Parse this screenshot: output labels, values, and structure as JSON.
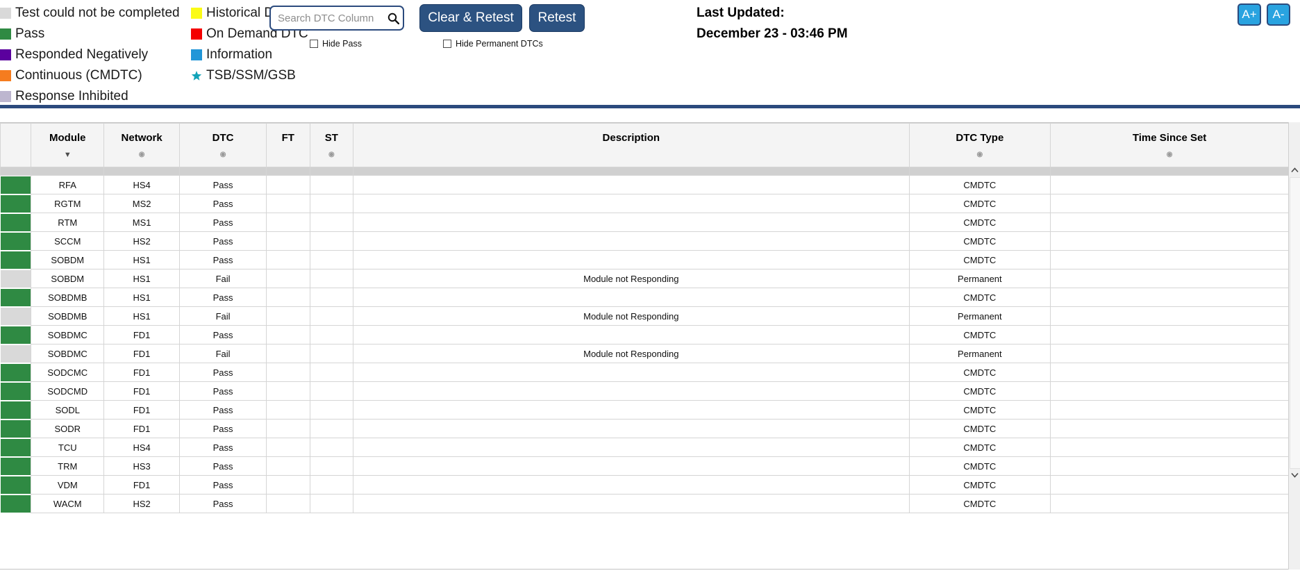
{
  "legend": {
    "left_column": [
      {
        "label": "Test could not be completed",
        "color": "#d9d9d9"
      },
      {
        "label": "Pass",
        "color": "#2f8a43"
      },
      {
        "label": "Responded Negatively",
        "color": "#5b009e"
      },
      {
        "label": "Continuous (CMDTC)",
        "color": "#f57c1f"
      },
      {
        "label": "Response Inhibited",
        "color": "#bdb6cf"
      }
    ],
    "right_column": [
      {
        "label": "Historical DTCs",
        "color": "#fbfb16",
        "icon": "square-swatch"
      },
      {
        "label": "On Demand DTC",
        "color": "#f40000",
        "icon": "square-swatch"
      },
      {
        "label": "Information",
        "color": "#2196d8",
        "icon": "square-swatch"
      },
      {
        "label": "TSB/SSM/GSB",
        "color": "#12a3b8",
        "icon": "star-icon"
      }
    ]
  },
  "toolbar": {
    "search_placeholder": "Search DTC Column",
    "search_value": "",
    "search_icon": "search-icon",
    "clear_retest_label": "Clear & Retest",
    "retest_label": "Retest",
    "hide_pass_label": "Hide Pass",
    "hide_pass_checked": false,
    "hide_permanent_label": "Hide Permanent DTCs",
    "hide_permanent_checked": false,
    "last_updated_title": "Last Updated:",
    "last_updated_value": "December 23 - 03:46 PM",
    "font_increase_label": "A+",
    "font_decrease_label": "A-",
    "accent_navy": "#2c5281",
    "accent_blue": "#29a3e0"
  },
  "table": {
    "columns": [
      {
        "key": "status",
        "label": "",
        "sort": ""
      },
      {
        "key": "module",
        "label": "Module",
        "sort": "▼"
      },
      {
        "key": "network",
        "label": "Network",
        "sort": "◉"
      },
      {
        "key": "dtc",
        "label": "DTC",
        "sort": "◉"
      },
      {
        "key": "ft",
        "label": "FT",
        "sort": ""
      },
      {
        "key": "st",
        "label": "ST",
        "sort": "◉"
      },
      {
        "key": "desc",
        "label": "Description",
        "sort": ""
      },
      {
        "key": "type",
        "label": "DTC Type",
        "sort": "◉"
      },
      {
        "key": "time",
        "label": "Time Since Set",
        "sort": "◉"
      }
    ],
    "rows": [
      {
        "status": "#2f8a43",
        "module": "RFA",
        "network": "HS4",
        "dtc": "Pass",
        "ft": "",
        "st": "",
        "desc": "",
        "type": "CMDTC",
        "time": ""
      },
      {
        "status": "#2f8a43",
        "module": "RGTM",
        "network": "MS2",
        "dtc": "Pass",
        "ft": "",
        "st": "",
        "desc": "",
        "type": "CMDTC",
        "time": ""
      },
      {
        "status": "#2f8a43",
        "module": "RTM",
        "network": "MS1",
        "dtc": "Pass",
        "ft": "",
        "st": "",
        "desc": "",
        "type": "CMDTC",
        "time": ""
      },
      {
        "status": "#2f8a43",
        "module": "SCCM",
        "network": "HS2",
        "dtc": "Pass",
        "ft": "",
        "st": "",
        "desc": "",
        "type": "CMDTC",
        "time": ""
      },
      {
        "status": "#2f8a43",
        "module": "SOBDM",
        "network": "HS1",
        "dtc": "Pass",
        "ft": "",
        "st": "",
        "desc": "",
        "type": "CMDTC",
        "time": ""
      },
      {
        "status": "#d9d9d9",
        "module": "SOBDM",
        "network": "HS1",
        "dtc": "Fail",
        "ft": "",
        "st": "",
        "desc": "Module not Responding",
        "type": "Permanent",
        "time": ""
      },
      {
        "status": "#2f8a43",
        "module": "SOBDMB",
        "network": "HS1",
        "dtc": "Pass",
        "ft": "",
        "st": "",
        "desc": "",
        "type": "CMDTC",
        "time": ""
      },
      {
        "status": "#d9d9d9",
        "module": "SOBDMB",
        "network": "HS1",
        "dtc": "Fail",
        "ft": "",
        "st": "",
        "desc": "Module not Responding",
        "type": "Permanent",
        "time": ""
      },
      {
        "status": "#2f8a43",
        "module": "SOBDMC",
        "network": "FD1",
        "dtc": "Pass",
        "ft": "",
        "st": "",
        "desc": "",
        "type": "CMDTC",
        "time": ""
      },
      {
        "status": "#d9d9d9",
        "module": "SOBDMC",
        "network": "FD1",
        "dtc": "Fail",
        "ft": "",
        "st": "",
        "desc": "Module not Responding",
        "type": "Permanent",
        "time": ""
      },
      {
        "status": "#2f8a43",
        "module": "SODCMC",
        "network": "FD1",
        "dtc": "Pass",
        "ft": "",
        "st": "",
        "desc": "",
        "type": "CMDTC",
        "time": ""
      },
      {
        "status": "#2f8a43",
        "module": "SODCMD",
        "network": "FD1",
        "dtc": "Pass",
        "ft": "",
        "st": "",
        "desc": "",
        "type": "CMDTC",
        "time": ""
      },
      {
        "status": "#2f8a43",
        "module": "SODL",
        "network": "FD1",
        "dtc": "Pass",
        "ft": "",
        "st": "",
        "desc": "",
        "type": "CMDTC",
        "time": ""
      },
      {
        "status": "#2f8a43",
        "module": "SODR",
        "network": "FD1",
        "dtc": "Pass",
        "ft": "",
        "st": "",
        "desc": "",
        "type": "CMDTC",
        "time": ""
      },
      {
        "status": "#2f8a43",
        "module": "TCU",
        "network": "HS4",
        "dtc": "Pass",
        "ft": "",
        "st": "",
        "desc": "",
        "type": "CMDTC",
        "time": ""
      },
      {
        "status": "#2f8a43",
        "module": "TRM",
        "network": "HS3",
        "dtc": "Pass",
        "ft": "",
        "st": "",
        "desc": "",
        "type": "CMDTC",
        "time": ""
      },
      {
        "status": "#2f8a43",
        "module": "VDM",
        "network": "FD1",
        "dtc": "Pass",
        "ft": "",
        "st": "",
        "desc": "",
        "type": "CMDTC",
        "time": ""
      },
      {
        "status": "#2f8a43",
        "module": "WACM",
        "network": "HS2",
        "dtc": "Pass",
        "ft": "",
        "st": "",
        "desc": "",
        "type": "CMDTC",
        "time": ""
      }
    ]
  },
  "scrollbar": {
    "up_arrow": "︿",
    "down_arrow": "﹀"
  }
}
